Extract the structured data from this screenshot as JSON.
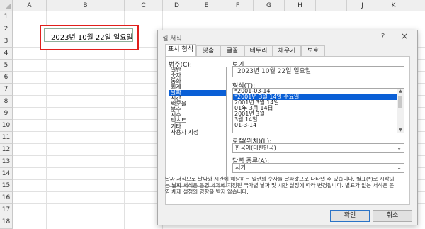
{
  "sheet": {
    "columns": [
      "A",
      "B",
      "C",
      "D",
      "E",
      "F",
      "G",
      "H",
      "I",
      "J",
      "K"
    ],
    "rows": [
      "1",
      "2",
      "3",
      "4",
      "5",
      "6",
      "7",
      "8",
      "9",
      "10",
      "11",
      "12",
      "13",
      "14",
      "15",
      "16",
      "17",
      "18",
      "19"
    ],
    "cell_B3_value": "2023년 10월 22일 일요일",
    "highlight_color": "#e0201c"
  },
  "dialog": {
    "title": "셀 서식",
    "help": "?",
    "close": "×",
    "tabs": [
      "표시 형식",
      "맞춤",
      "글꼴",
      "테두리",
      "채우기",
      "보호"
    ],
    "active_tab": "표시 형식",
    "category_label": "범주(C):",
    "categories": [
      "일반",
      "숫자",
      "통화",
      "회계",
      "날짜",
      "시간",
      "백분율",
      "분수",
      "지수",
      "텍스트",
      "기타",
      "사용자 지정"
    ],
    "selected_category": "날짜",
    "sample_label": "보기",
    "sample_value": "2023년 10월 22일 일요일",
    "format_label": "형식(T):",
    "formats": [
      "*2001-03-14",
      "*2001년 3월 14일 수요일",
      "2001년 3월 14일",
      "01年 3月 14日",
      "2001년 3월",
      "3월 14일",
      "01-3-14"
    ],
    "selected_format": "*2001년 3월 14일 수요일",
    "locale_label": "로캘(위치)(L):",
    "locale_value": "한국어(대한민국)",
    "calendar_label": "달력 종류(A):",
    "calendar_value": "서기",
    "description": "날짜 서식으로 날짜와 시간에 해당하는 일련의 숫자를 날짜값으로 나타낼 수 있습니다. 별표(*)로 시작되는 날짜 서식은 운영 체제에 지정된 국가별 날짜 및 시간 설정에 따라 변경됩니다. 별표가 없는 서식은 운영 체제 설정의 영향을 받지 않습니다.",
    "ok_label": "확인",
    "cancel_label": "취소",
    "accent_color": "#0a5fd6"
  }
}
